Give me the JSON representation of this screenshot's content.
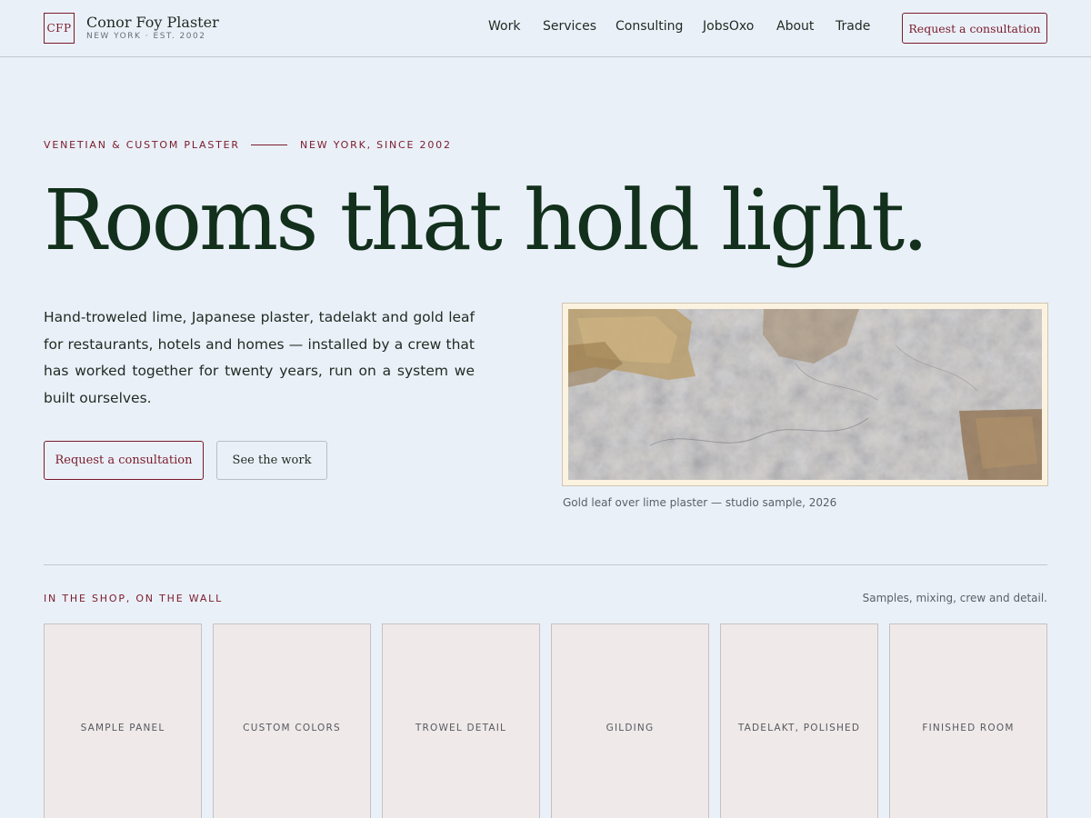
{
  "brand": {
    "mark": "CFP",
    "name": "Conor Foy Plaster",
    "tagline": "NEW YORK · EST. 2002"
  },
  "nav": {
    "items": [
      "Work",
      "Services",
      "Consulting",
      "JobsOxo",
      "About",
      "Trade"
    ],
    "cta_label": "Request a consultation"
  },
  "hero": {
    "eyebrow_left": "VENETIAN & CUSTOM PLASTER",
    "eyebrow_right": "NEW YORK, SINCE 2002",
    "title": "Rooms that hold light.",
    "body": "Hand-troweled lime, Japanese plaster, tadelakt and gold leaf for restaurants, hotels and homes — installed by a crew that has worked together for twenty years, run on a system we built ourselves.",
    "primary_button": "Request a consultation",
    "secondary_button": "See the work",
    "image_caption": "Gold leaf over lime plaster — studio sample, 2026"
  },
  "gallery": {
    "eyebrow": "IN THE SHOP, ON THE WALL",
    "note": "Samples, mixing, crew and detail.",
    "tiles": [
      "SAMPLE PANEL",
      "CUSTOM COLORS",
      "TROWEL DETAIL",
      "GILDING",
      "TADELAKT, POLISHED",
      "FINISHED ROOM"
    ]
  },
  "colors": {
    "background": "#eaf0f8",
    "accent": "#7a1b2a",
    "heading": "#12301c",
    "tile_bg": "#f0e9e9"
  }
}
